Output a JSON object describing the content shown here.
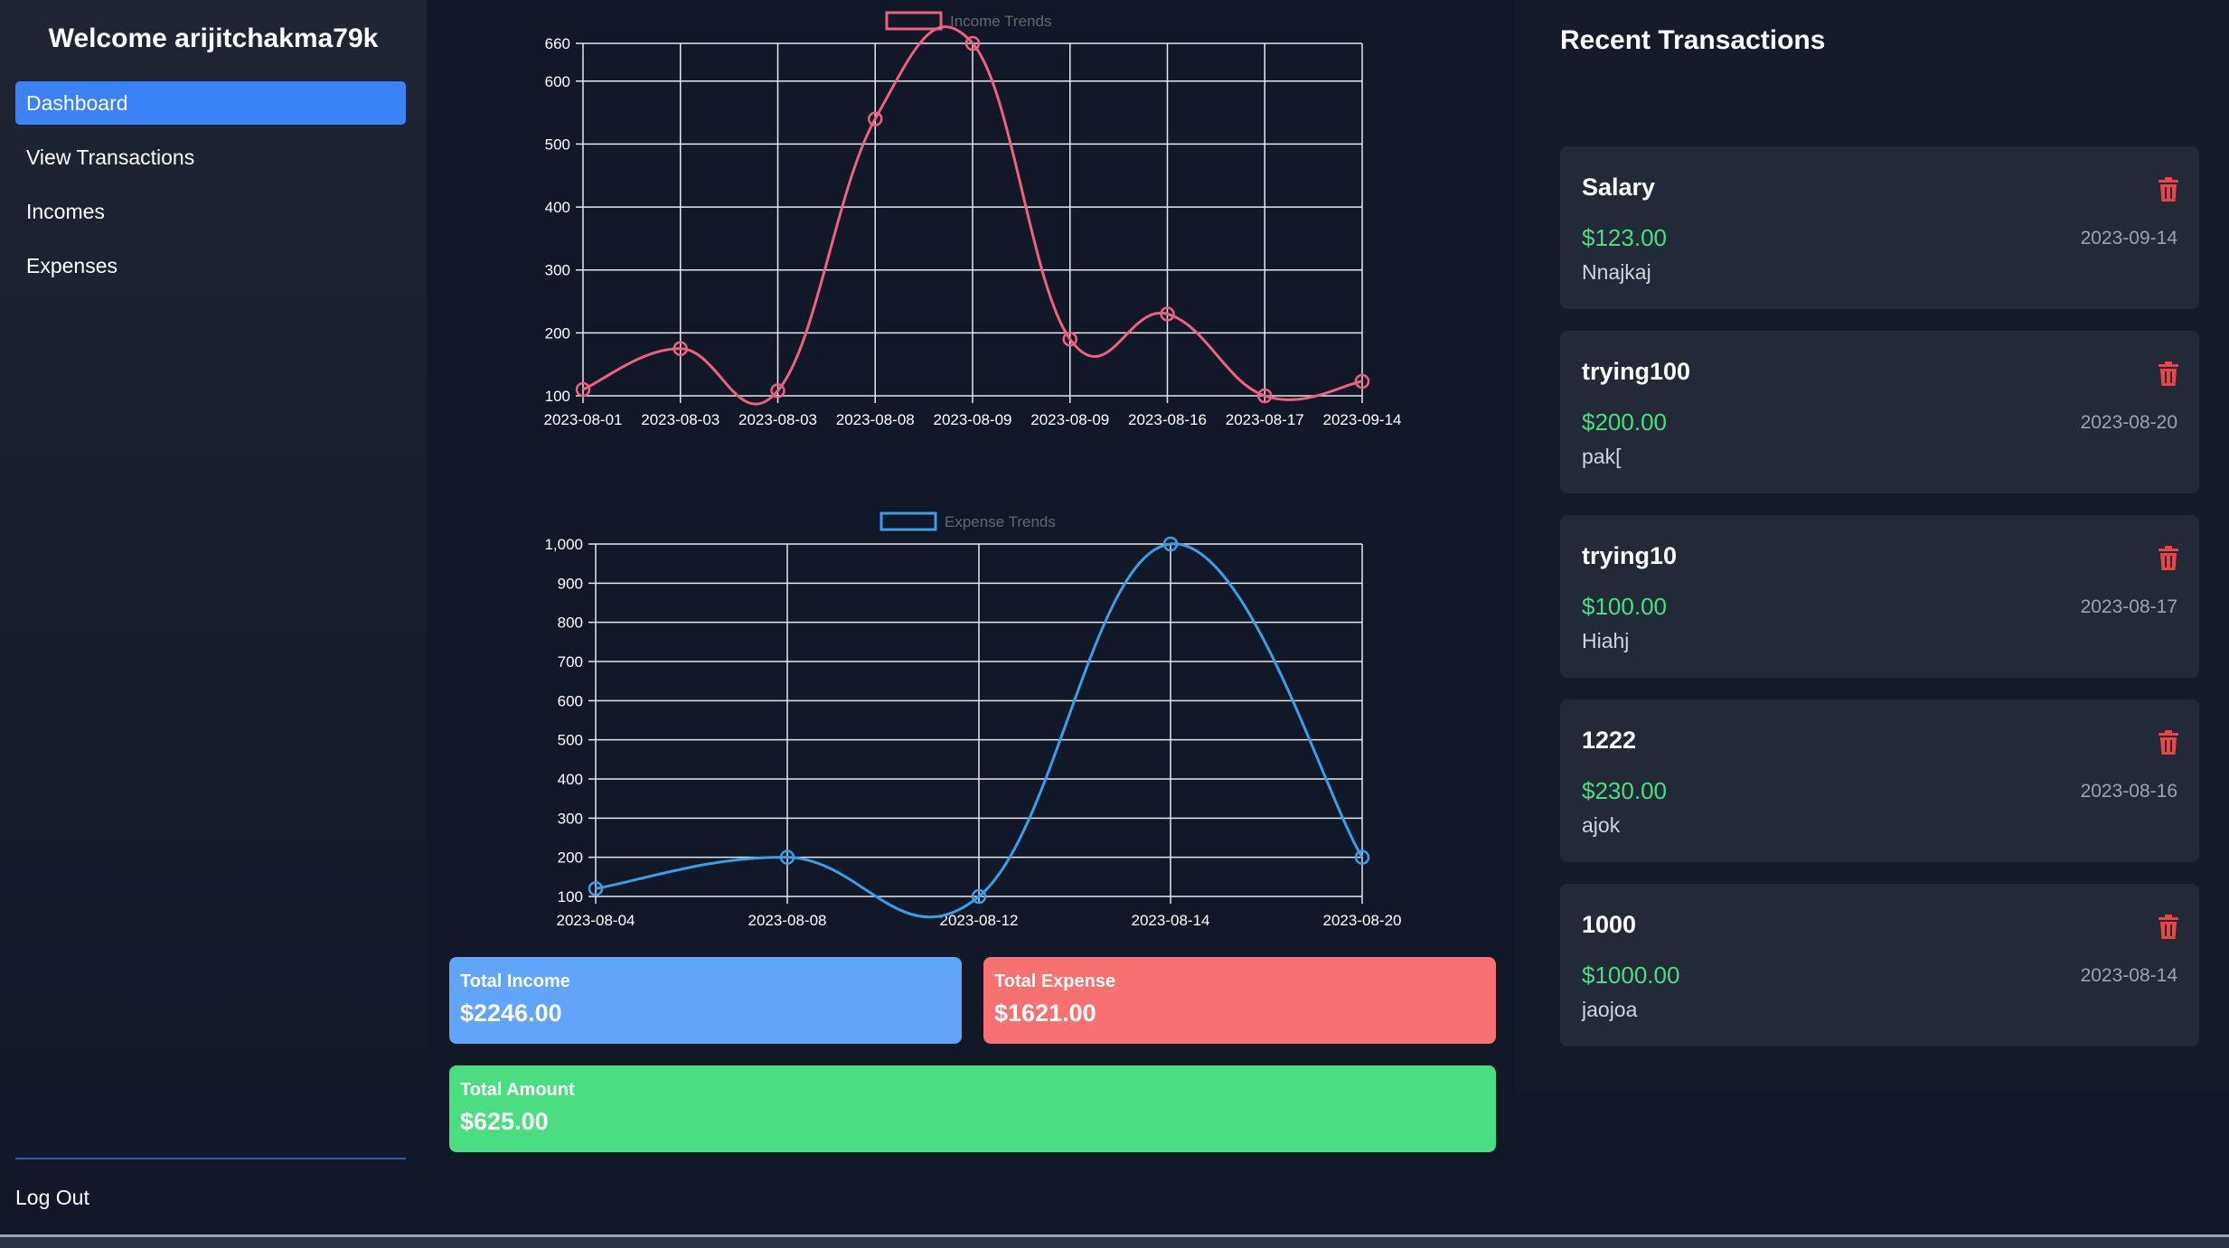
{
  "sidebar": {
    "welcome": "Welcome arijitchakma79k",
    "nav": [
      {
        "label": "Dashboard",
        "active": true
      },
      {
        "label": "View Transactions",
        "active": false
      },
      {
        "label": "Incomes",
        "active": false
      },
      {
        "label": "Expenses",
        "active": false
      }
    ],
    "logout_label": "Log Out"
  },
  "chart_data": [
    {
      "type": "line",
      "title": "",
      "series": [
        {
          "name": "Income Trends",
          "color": "#f0607f",
          "values": [
            110,
            175,
            108,
            540,
            660,
            190,
            230,
            100,
            123
          ]
        }
      ],
      "categories": [
        "2023-08-01",
        "2023-08-03",
        "2023-08-03",
        "2023-08-08",
        "2023-08-09",
        "2023-08-09",
        "2023-08-16",
        "2023-08-17",
        "2023-09-14"
      ],
      "yticks": [
        "100",
        "200",
        "300",
        "400",
        "500",
        "600",
        "660"
      ],
      "ylim": [
        100,
        660
      ],
      "legend": "top",
      "grid": true
    },
    {
      "type": "line",
      "title": "",
      "series": [
        {
          "name": "Expense Trends",
          "color": "#3b9ee8",
          "values": [
            120,
            200,
            100,
            1000,
            200
          ]
        }
      ],
      "categories": [
        "2023-08-04",
        "2023-08-08",
        "2023-08-12",
        "2023-08-14",
        "2023-08-20"
      ],
      "yticks": [
        "100",
        "200",
        "300",
        "400",
        "500",
        "600",
        "700",
        "800",
        "900",
        "1,000"
      ],
      "ylim": [
        100,
        1000
      ],
      "legend": "top",
      "grid": true
    }
  ],
  "summary": {
    "income_label": "Total Income",
    "income_value": "$2246.00",
    "expense_label": "Total Expense",
    "expense_value": "$1621.00",
    "total_label": "Total Amount",
    "total_value": "$625.00"
  },
  "recent": {
    "title": "Recent Transactions",
    "items": [
      {
        "name": "Salary",
        "amount": "$123.00",
        "date": "2023-09-14",
        "desc": "Nnajkaj"
      },
      {
        "name": "trying100",
        "amount": "$200.00",
        "date": "2023-08-20",
        "desc": "pak["
      },
      {
        "name": "trying10",
        "amount": "$100.00",
        "date": "2023-08-17",
        "desc": "Hiahj"
      },
      {
        "name": "1222",
        "amount": "$230.00",
        "date": "2023-08-16",
        "desc": "ajok"
      },
      {
        "name": "1000",
        "amount": "$1000.00",
        "date": "2023-08-14",
        "desc": "jaojoa"
      }
    ],
    "delete_icon": "trash-icon",
    "delete_color": "#ef4444"
  }
}
